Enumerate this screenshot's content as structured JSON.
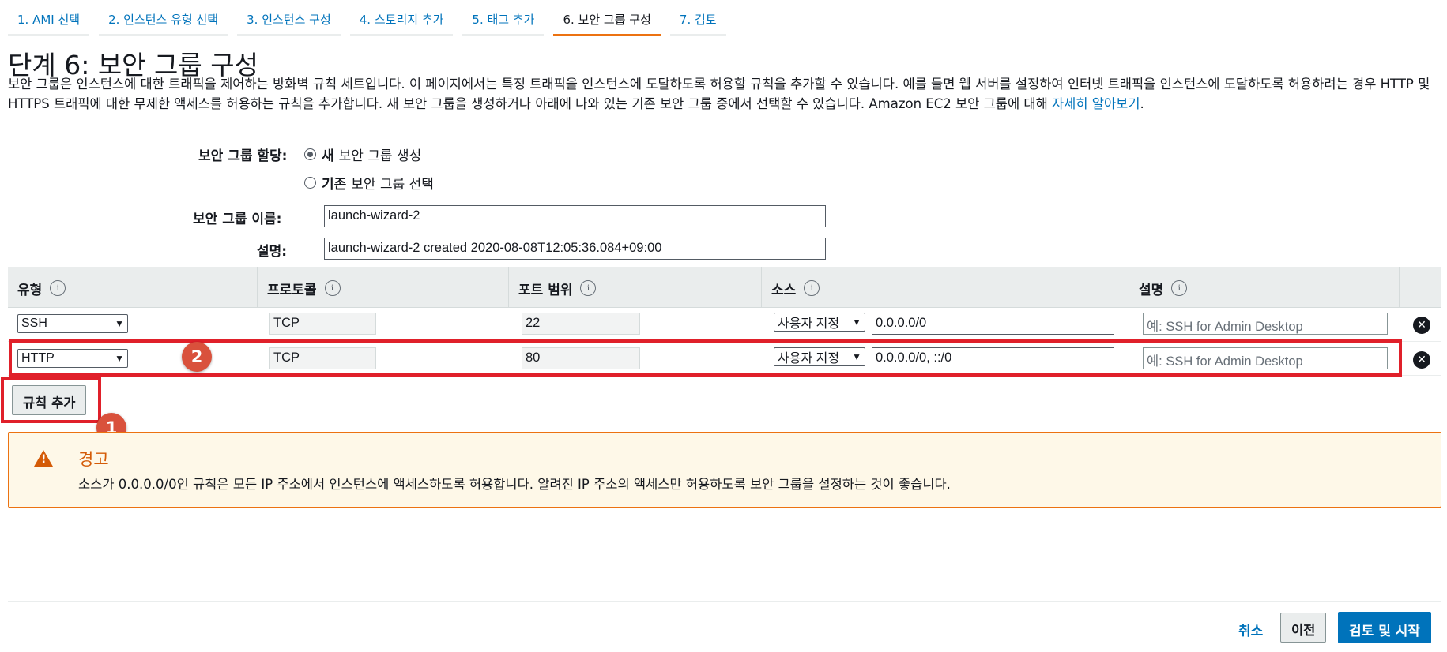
{
  "wizard": {
    "tabs": [
      {
        "label": "1. AMI 선택"
      },
      {
        "label": "2. 인스턴스 유형 선택"
      },
      {
        "label": "3. 인스턴스 구성"
      },
      {
        "label": "4. 스토리지 추가"
      },
      {
        "label": "5. 태그 추가"
      },
      {
        "label": "6. 보안 그룹 구성"
      },
      {
        "label": "7. 검토"
      }
    ],
    "active_tab": 5
  },
  "page": {
    "title": "단계 6: 보안 그룹 구성",
    "intro": "보안 그룹은 인스턴스에 대한 트래픽을 제어하는 방화벽 규칙 세트입니다. 이 페이지에서는 특정 트래픽을 인스턴스에 도달하도록 허용할 규칙을 추가할 수 있습니다. 예를 들면 웹 서버를 설정하여 인터넷 트래픽을 인스턴스에 도달하도록 허용하려는 경우 HTTP 및 HTTPS 트래픽에 대한 무제한 액세스를 허용하는 규칙을 추가합니다. 새 보안 그룹을 생성하거나 아래에 나와 있는 기존 보안 그룹 중에서 선택할 수 있습니다. Amazon EC2 보안 그룹에 대해 ",
    "learn_more": "자세히 알아보기",
    "intro_end": "."
  },
  "form": {
    "assign_label": "보안 그룹 할당:",
    "option_new_bold": "새",
    "option_new_rest": "보안 그룹 생성",
    "option_existing_bold": "기존",
    "option_existing_rest": "보안 그룹 선택",
    "selected_option": "new",
    "name_label": "보안 그룹 이름:",
    "name_value": "launch-wizard-2",
    "desc_label": "설명:",
    "desc_value": "launch-wizard-2 created 2020-08-08T12:05:36.084+09:00"
  },
  "table": {
    "headers": [
      "유형",
      "프로토콜",
      "포트 범위",
      "소스",
      "설명"
    ],
    "info_icon": "i",
    "rows": [
      {
        "type": "SSH",
        "protocol": "TCP",
        "port": "22",
        "source_mode": "사용자 지정",
        "source": "0.0.0.0/0",
        "desc_placeholder": "예: SSH for Admin Desktop"
      },
      {
        "type": "HTTP",
        "protocol": "TCP",
        "port": "80",
        "source_mode": "사용자 지정",
        "source": "0.0.0.0/0, ::/0",
        "desc_placeholder": "예: SSH for Admin Desktop"
      }
    ],
    "delete_icon": "✕"
  },
  "add_rule_label": "규칙 추가",
  "annotations": {
    "badge1": "1",
    "badge2": "2",
    "highlight_color": "#e0202a"
  },
  "warning": {
    "title": "경고",
    "text": "소스가 0.0.0.0/0인 규칙은 모든 IP 주소에서 인스턴스에 액세스하도록 허용합니다. 알려진 IP 주소의 액세스만 허용하도록 보안 그룹을 설정하는 것이 좋습니다.",
    "icon": "!"
  },
  "footer": {
    "cancel": "취소",
    "previous": "이전",
    "review_launch": "검토 및 시작"
  },
  "colors": {
    "accent": "#0073bb",
    "active_tab": "#ec7211",
    "warning": "#d45b07"
  }
}
